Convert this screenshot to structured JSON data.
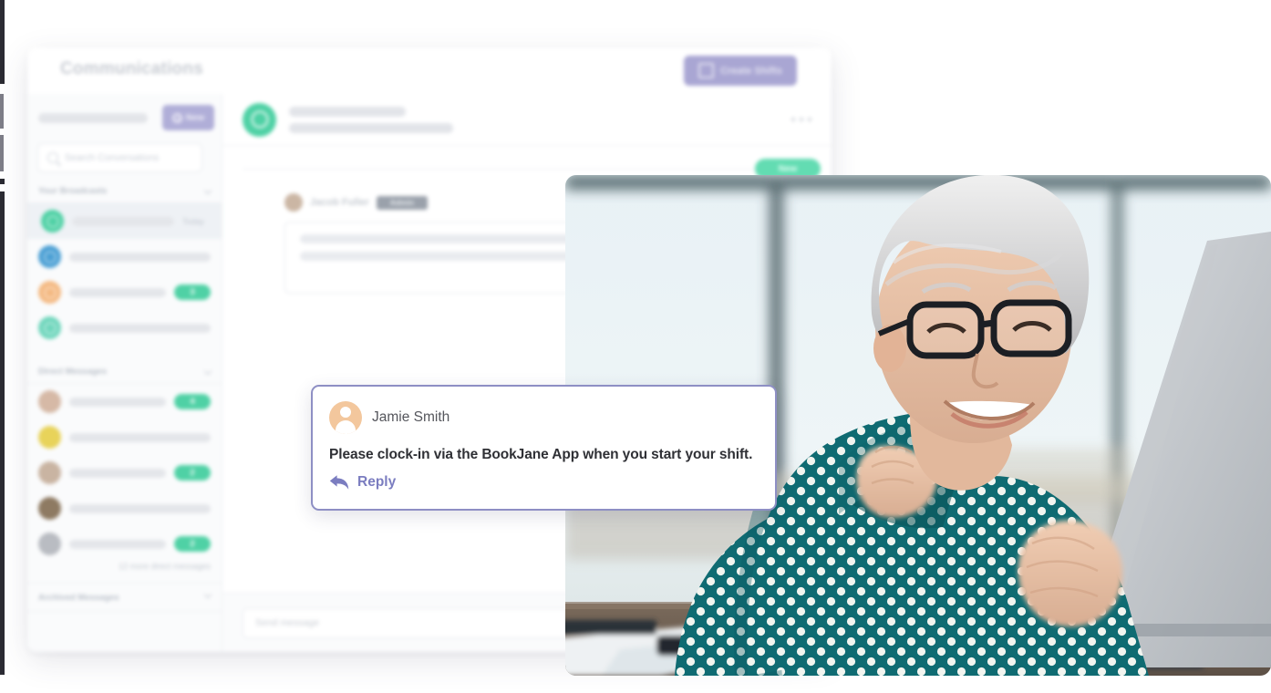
{
  "window": {
    "title": "Communications",
    "create_shifts_button": "Create Shifts",
    "overflow_menu": "···"
  },
  "sidebar": {
    "new_button": "New",
    "search_placeholder": "Search Conversations",
    "sections": [
      {
        "title": "Your Broadcasts",
        "collapse_icon": "chevron-down-icon"
      },
      {
        "title": "Direct Messages",
        "collapse_icon": "chevron-down-icon"
      },
      {
        "title": "Archived Messages",
        "collapse_icon": "chevron-down-icon"
      }
    ],
    "broadcasts": [
      {
        "avatar_color": "#4fd1a5",
        "active": true,
        "time": "Today",
        "badge": ""
      },
      {
        "avatar_color": "#4a9fd4",
        "active": false,
        "time": "",
        "badge": ""
      },
      {
        "avatar_color": "#f4b982",
        "active": false,
        "time": "",
        "badge": "3"
      },
      {
        "avatar_color": "#6fd6bc",
        "active": false,
        "time": "",
        "badge": ""
      }
    ],
    "direct_messages": [
      {
        "avatar_color": "#d6b9a6",
        "badge": "4"
      },
      {
        "avatar_color": "#e8d35a",
        "badge": ""
      },
      {
        "avatar_color": "#c9b4a2",
        "badge": "2"
      },
      {
        "avatar_color": "#8e7a62",
        "badge": ""
      },
      {
        "avatar_color": "#b9bcc2",
        "badge": "2"
      }
    ],
    "more_direct_messages": "12 more direct messages"
  },
  "conversation": {
    "header_avatar_color": "#4fd1a5",
    "new_badge": "New",
    "message_author": "Jacob Fuller",
    "author_tag": "Admin",
    "composer_placeholder": "Send message"
  },
  "callout": {
    "avatar_icon": "person-avatar-icon",
    "name": "Jamie Smith",
    "message": "Please clock-in via the BookJane App when you start your shift.",
    "reply_label": "Reply",
    "reply_icon": "reply-arrow-icon",
    "border_color": "#8e8fc4",
    "accent_color": "#7b7dc0"
  },
  "photo": {
    "alt": "Smiling woman with short gray hair and glasses wearing a teal polka-dot blouse, working at a laptop in a bright office"
  },
  "colors": {
    "green_accent": "#4fd1a5",
    "purple_accent": "#a9a6d3",
    "text_dark": "#2f3035"
  }
}
